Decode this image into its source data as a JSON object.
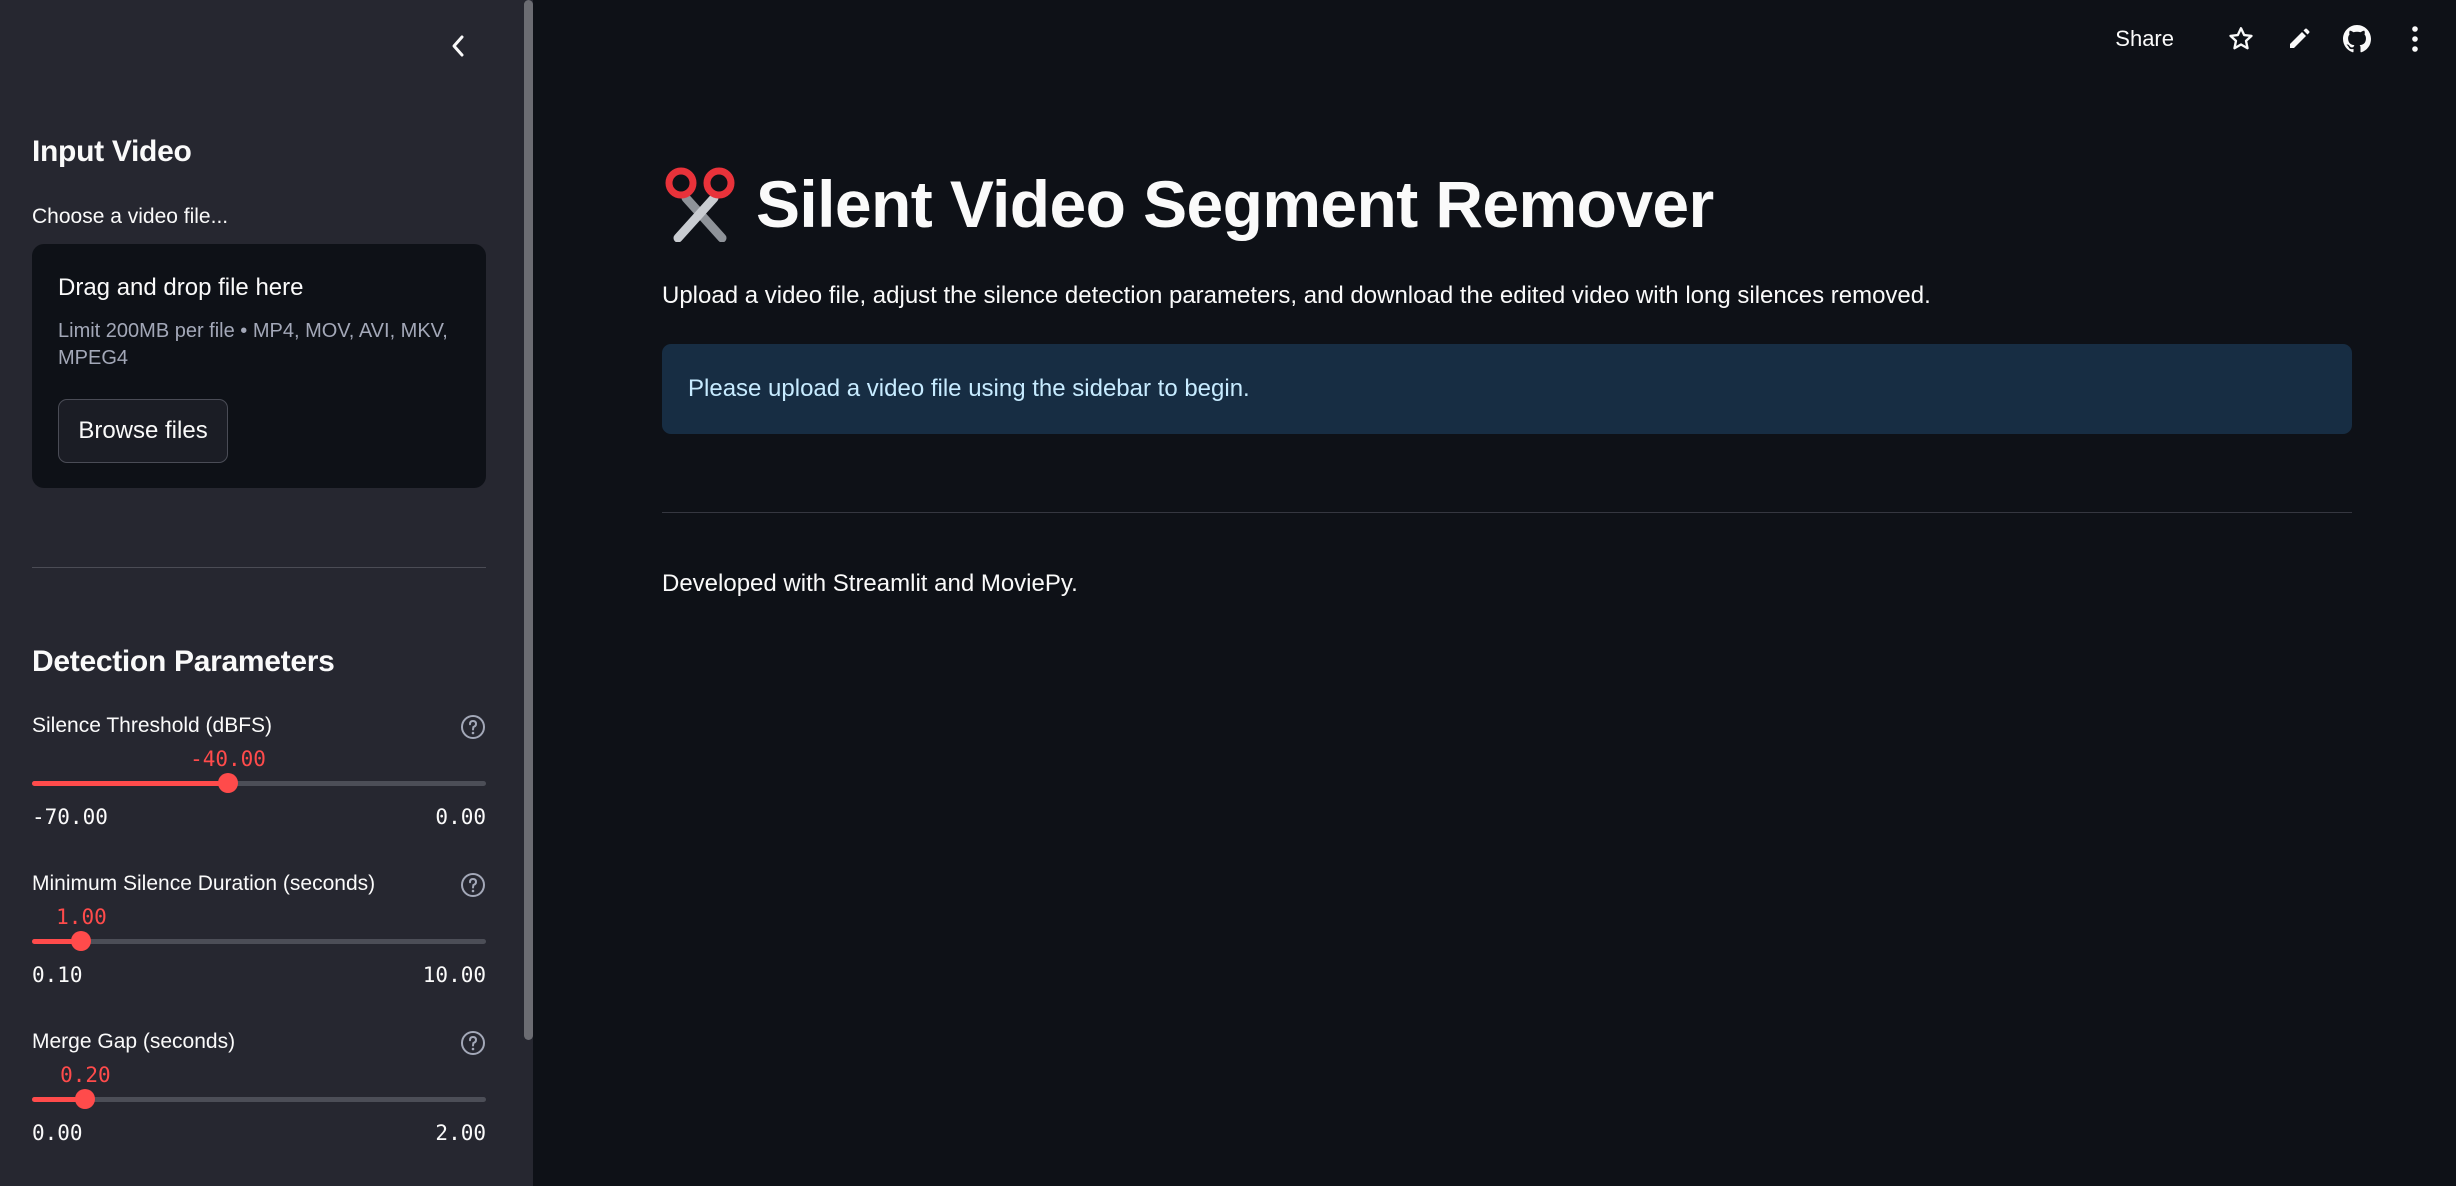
{
  "header": {
    "share_label": "Share",
    "icons": [
      "star-icon",
      "edit-pencil-icon",
      "github-icon",
      "more-vertical-icon"
    ]
  },
  "sidebar": {
    "collapse_icon": "chevron-left-icon",
    "input_section": {
      "heading": "Input Video",
      "uploader_label": "Choose a video file...",
      "drop_title": "Drag and drop file here",
      "limit_text": "Limit 200MB per file • MP4, MOV, AVI, MKV, MPEG4",
      "browse_label": "Browse files"
    },
    "detection_section": {
      "heading": "Detection Parameters",
      "sliders": [
        {
          "label": "Silence Threshold (dBFS)",
          "value": -40.0,
          "value_label": "-40.00",
          "min": -70.0,
          "max": 0.0,
          "min_label": "-70.00",
          "max_label": "0.00"
        },
        {
          "label": "Minimum Silence Duration (seconds)",
          "value": 1.0,
          "value_label": "1.00",
          "min": 0.1,
          "max": 10.0,
          "min_label": "0.10",
          "max_label": "10.00"
        },
        {
          "label": "Merge Gap (seconds)",
          "value": 0.2,
          "value_label": "0.20",
          "min": 0.0,
          "max": 2.0,
          "min_label": "0.00",
          "max_label": "2.00"
        }
      ]
    }
  },
  "main": {
    "title_icon": "scissors-icon",
    "title": "Silent Video Segment Remover",
    "subtitle": "Upload a video file, adjust the silence detection parameters, and download the edited video with long silences removed.",
    "info_message": "Please upload a video file using the sidebar to begin.",
    "footer": "Developed with Streamlit and MoviePy."
  },
  "colors": {
    "background": "#0e1117",
    "sidebar": "#262730",
    "accent": "#ff4b4b",
    "info_bg": "#172d43",
    "info_text": "#c7ebff"
  }
}
